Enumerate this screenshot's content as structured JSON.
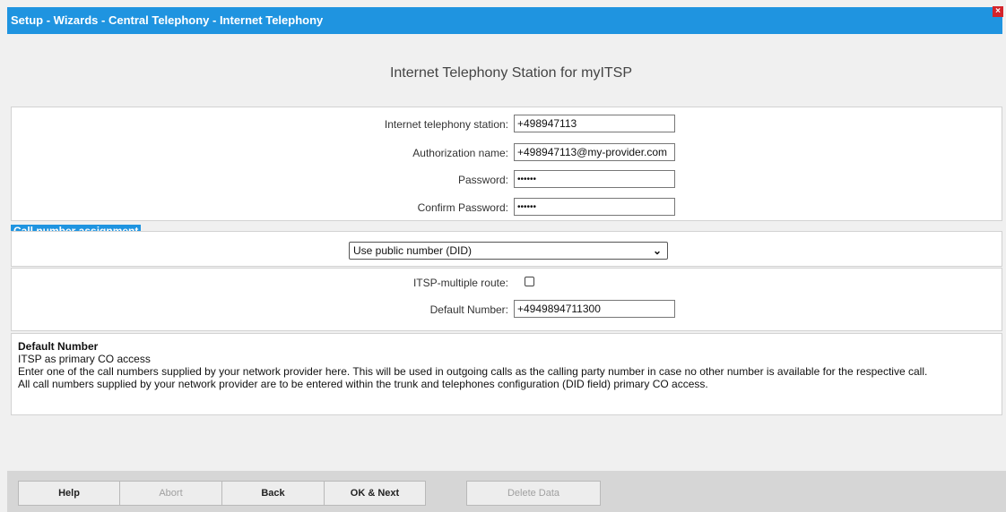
{
  "window": {
    "title": "Setup - Wizards - Central Telephony - Internet Telephony",
    "close_label": "×"
  },
  "page": {
    "heading": "Internet Telephony Station for myITSP"
  },
  "station_form": {
    "station_label": "Internet telephony station:",
    "station_value": "+498947113",
    "auth_label": "Authorization name:",
    "auth_value": "+498947113@my-provider.com",
    "password_label": "Password:",
    "password_value": "••••••",
    "confirm_label": "Confirm Password:",
    "confirm_value": "••••••"
  },
  "call_number_assignment": {
    "section_label": "Call number assignment",
    "selected_option": "Use public number (DID)",
    "chevron": "⌄"
  },
  "route_form": {
    "multiple_route_label": "ITSP-multiple route:",
    "multiple_route_checked": false,
    "default_number_label": "Default Number:",
    "default_number_value": "+4949894711300"
  },
  "info": {
    "title": "Default Number",
    "line1": "ITSP as primary CO access",
    "line2": "Enter one of the call numbers supplied by your network provider here. This will be used in outgoing calls as the calling party number in case no other number is available for the respective call.",
    "line3": "All call numbers supplied by your network provider are to be entered within the trunk and telephones configuration (DID field) primary CO access."
  },
  "footer": {
    "help_label": "Help",
    "abort_label": "Abort",
    "back_label": "Back",
    "ok_next_label": "OK & Next",
    "delete_label": "Delete Data"
  }
}
